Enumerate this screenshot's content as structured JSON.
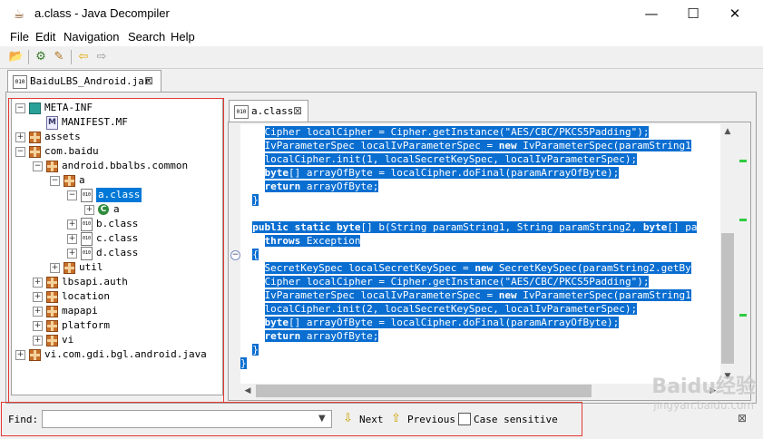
{
  "window": {
    "title": "a.class - Java Decompiler",
    "minimize": "—",
    "maximize": "☐",
    "close": "✕"
  },
  "menu": [
    "File",
    "Edit",
    "Navigation",
    "Search",
    "Help"
  ],
  "toolbar": {
    "icons": [
      "open-file-icon",
      "open-type-icon",
      "search-icon",
      "back-arrow-icon",
      "forward-arrow-icon"
    ]
  },
  "outer_tab": {
    "label": "BaiduLBS_Android.jar",
    "close": "⊠"
  },
  "tree": [
    {
      "label": "META-INF",
      "level": 0,
      "toggle": "−",
      "icon": "meta"
    },
    {
      "label": "MANIFEST.MF",
      "level": 1,
      "toggle": "",
      "icon": "manifest"
    },
    {
      "label": "assets",
      "level": 0,
      "toggle": "+",
      "icon": "package"
    },
    {
      "label": "com.baidu",
      "level": 0,
      "toggle": "−",
      "icon": "package"
    },
    {
      "label": "android.bbalbs.common",
      "level": 1,
      "toggle": "−",
      "icon": "package"
    },
    {
      "label": "a",
      "level": 2,
      "toggle": "−",
      "icon": "package"
    },
    {
      "label": "a.class",
      "level": 3,
      "toggle": "−",
      "icon": "file",
      "selected": true
    },
    {
      "label": "a",
      "level": 4,
      "toggle": "+",
      "icon": "class"
    },
    {
      "label": "b.class",
      "level": 3,
      "toggle": "+",
      "icon": "file"
    },
    {
      "label": "c.class",
      "level": 3,
      "toggle": "+",
      "icon": "file"
    },
    {
      "label": "d.class",
      "level": 3,
      "toggle": "+",
      "icon": "file"
    },
    {
      "label": "util",
      "level": 2,
      "toggle": "+",
      "icon": "package"
    },
    {
      "label": "lbsapi.auth",
      "level": 1,
      "toggle": "+",
      "icon": "package"
    },
    {
      "label": "location",
      "level": 1,
      "toggle": "+",
      "icon": "package"
    },
    {
      "label": "mapapi",
      "level": 1,
      "toggle": "+",
      "icon": "package"
    },
    {
      "label": "platform",
      "level": 1,
      "toggle": "+",
      "icon": "package"
    },
    {
      "label": "vi",
      "level": 1,
      "toggle": "+",
      "icon": "package"
    },
    {
      "label": "vi.com.gdi.bgl.android.java",
      "level": 0,
      "toggle": "+",
      "icon": "package"
    }
  ],
  "file_icon_text": "010",
  "class_icon_text": "C",
  "inner_tab": {
    "label": "a.class",
    "close": "⊠"
  },
  "code": [
    {
      "indent": "    ",
      "text": "Cipher localCipher = Cipher.getInstance(\"AES/CBC/PKCS5Padding\");",
      "hl": true
    },
    {
      "indent": "    ",
      "text": "IvParameterSpec localIvParameterSpec = new IvParameterSpec(paramString1",
      "hl": true
    },
    {
      "indent": "    ",
      "text": "localCipher.init(1, localSecretKeySpec, localIvParameterSpec);",
      "hl": true
    },
    {
      "indent": "    ",
      "text": "byte[] arrayOfByte = localCipher.doFinal(paramArrayOfByte);",
      "hl": true
    },
    {
      "indent": "    ",
      "text": "return arrayOfByte;",
      "hl": true
    },
    {
      "indent": "  ",
      "text": "}",
      "hl": true
    },
    {
      "indent": "",
      "text": "",
      "hl": false
    },
    {
      "indent": "  ",
      "text": "public static byte[] b(String paramString1, String paramString2, byte[] pa",
      "hl": true
    },
    {
      "indent": "    ",
      "text": "throws Exception",
      "hl": true
    },
    {
      "indent": "  ",
      "text": "{",
      "hl": true
    },
    {
      "indent": "    ",
      "text": "SecretKeySpec localSecretKeySpec = new SecretKeySpec(paramString2.getBy",
      "hl": true
    },
    {
      "indent": "    ",
      "text": "Cipher localCipher = Cipher.getInstance(\"AES/CBC/PKCS5Padding\");",
      "hl": true
    },
    {
      "indent": "    ",
      "text": "IvParameterSpec localIvParameterSpec = new IvParameterSpec(paramString1",
      "hl": true
    },
    {
      "indent": "    ",
      "text": "localCipher.init(2, localSecretKeySpec, localIvParameterSpec);",
      "hl": true
    },
    {
      "indent": "    ",
      "text": "byte[] arrayOfByte = localCipher.doFinal(paramArrayOfByte);",
      "hl": true
    },
    {
      "indent": "    ",
      "text": "return arrayOfByte;",
      "hl": true
    },
    {
      "indent": "  ",
      "text": "}",
      "hl": true
    },
    {
      "indent": "",
      "text": "}",
      "hl": true
    }
  ],
  "keywords": [
    "public",
    "static",
    "byte",
    "new",
    "return",
    "throws"
  ],
  "find": {
    "label": "Find:",
    "value": "",
    "next": "Next",
    "previous": "Previous",
    "case_sensitive": "Case sensitive",
    "case_checked": false,
    "close": "⊠"
  },
  "watermark": {
    "line1": "Baidu经验",
    "line2": "jingyan.baidu.com"
  },
  "colors": {
    "selection": "#0a6ed1",
    "tree_selection": "#0078d7",
    "find_outline": "#e53935",
    "overview_marks": "#2ecc40"
  }
}
